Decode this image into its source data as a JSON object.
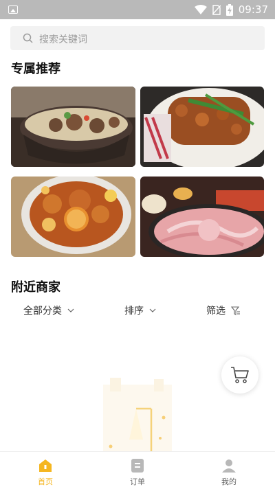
{
  "status_bar": {
    "time": "09:37"
  },
  "search": {
    "placeholder": "搜索关键词"
  },
  "recommend": {
    "title": "专属推荐"
  },
  "nearby": {
    "title": "附近商家",
    "filters": [
      "全部分类",
      "排序",
      "筛选"
    ]
  },
  "tabs": [
    "首页",
    "订单",
    "我的"
  ],
  "colors": {
    "accent": "#f5b620",
    "status_bar": "#b9b9b9",
    "search_bg": "#f2f2f2"
  },
  "icons": {
    "status": [
      "image-icon",
      "wifi-icon",
      "no-sim-icon",
      "battery-charging-icon"
    ],
    "search": "search-icon",
    "filter": "funnel-icon",
    "cart": "shopping-cart-icon",
    "tabs": [
      "home-icon",
      "orders-icon",
      "profile-icon"
    ]
  }
}
